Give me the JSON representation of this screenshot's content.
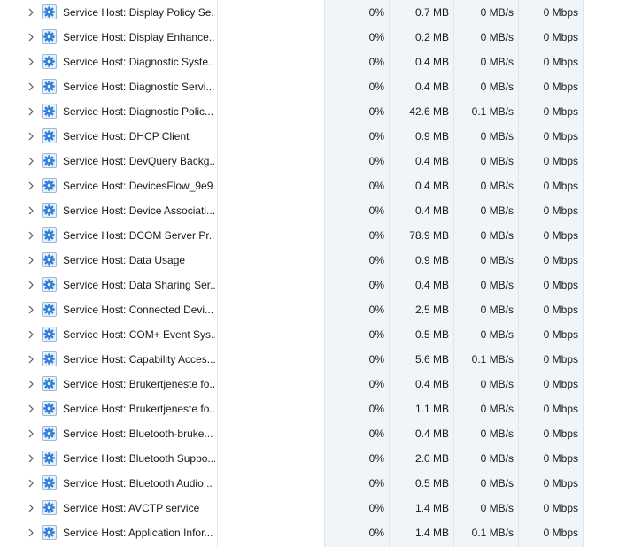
{
  "processes": [
    {
      "name": "Service Host: Display Policy Se...",
      "cpu": "0%",
      "memory": "0.7 MB",
      "disk": "0 MB/s",
      "network": "0 Mbps"
    },
    {
      "name": "Service Host: Display Enhance...",
      "cpu": "0%",
      "memory": "0.2 MB",
      "disk": "0 MB/s",
      "network": "0 Mbps"
    },
    {
      "name": "Service Host: Diagnostic Syste...",
      "cpu": "0%",
      "memory": "0.4 MB",
      "disk": "0 MB/s",
      "network": "0 Mbps"
    },
    {
      "name": "Service Host: Diagnostic Servi...",
      "cpu": "0%",
      "memory": "0.4 MB",
      "disk": "0 MB/s",
      "network": "0 Mbps"
    },
    {
      "name": "Service Host: Diagnostic Polic...",
      "cpu": "0%",
      "memory": "42.6 MB",
      "disk": "0.1 MB/s",
      "network": "0 Mbps"
    },
    {
      "name": "Service Host: DHCP Client",
      "cpu": "0%",
      "memory": "0.9 MB",
      "disk": "0 MB/s",
      "network": "0 Mbps"
    },
    {
      "name": "Service Host: DevQuery Backg...",
      "cpu": "0%",
      "memory": "0.4 MB",
      "disk": "0 MB/s",
      "network": "0 Mbps"
    },
    {
      "name": "Service Host: DevicesFlow_9e9...",
      "cpu": "0%",
      "memory": "0.4 MB",
      "disk": "0 MB/s",
      "network": "0 Mbps"
    },
    {
      "name": "Service Host: Device Associati...",
      "cpu": "0%",
      "memory": "0.4 MB",
      "disk": "0 MB/s",
      "network": "0 Mbps"
    },
    {
      "name": "Service Host: DCOM Server Pr...",
      "cpu": "0%",
      "memory": "78.9 MB",
      "disk": "0 MB/s",
      "network": "0 Mbps"
    },
    {
      "name": "Service Host: Data Usage",
      "cpu": "0%",
      "memory": "0.9 MB",
      "disk": "0 MB/s",
      "network": "0 Mbps"
    },
    {
      "name": "Service Host: Data Sharing Ser...",
      "cpu": "0%",
      "memory": "0.4 MB",
      "disk": "0 MB/s",
      "network": "0 Mbps"
    },
    {
      "name": "Service Host: Connected Devi...",
      "cpu": "0%",
      "memory": "2.5 MB",
      "disk": "0 MB/s",
      "network": "0 Mbps"
    },
    {
      "name": "Service Host: COM+ Event Sys...",
      "cpu": "0%",
      "memory": "0.5 MB",
      "disk": "0 MB/s",
      "network": "0 Mbps"
    },
    {
      "name": "Service Host: Capability Acces...",
      "cpu": "0%",
      "memory": "5.6 MB",
      "disk": "0.1 MB/s",
      "network": "0 Mbps"
    },
    {
      "name": "Service Host: Brukertjeneste fo...",
      "cpu": "0%",
      "memory": "0.4 MB",
      "disk": "0 MB/s",
      "network": "0 Mbps"
    },
    {
      "name": "Service Host: Brukertjeneste fo...",
      "cpu": "0%",
      "memory": "1.1 MB",
      "disk": "0 MB/s",
      "network": "0 Mbps"
    },
    {
      "name": "Service Host: Bluetooth-bruke...",
      "cpu": "0%",
      "memory": "0.4 MB",
      "disk": "0 MB/s",
      "network": "0 Mbps"
    },
    {
      "name": "Service Host: Bluetooth Suppo...",
      "cpu": "0%",
      "memory": "2.0 MB",
      "disk": "0 MB/s",
      "network": "0 Mbps"
    },
    {
      "name": "Service Host: Bluetooth Audio...",
      "cpu": "0%",
      "memory": "0.5 MB",
      "disk": "0 MB/s",
      "network": "0 Mbps"
    },
    {
      "name": "Service Host: AVCTP service",
      "cpu": "0%",
      "memory": "1.4 MB",
      "disk": "0 MB/s",
      "network": "0 Mbps"
    },
    {
      "name": "Service Host: Application Infor...",
      "cpu": "0%",
      "memory": "1.4 MB",
      "disk": "0.1 MB/s",
      "network": "0 Mbps"
    }
  ],
  "icons": {
    "expand": "chevron-right-icon",
    "process": "gear-icon"
  },
  "colors": {
    "metric_column_background": "#f0f5f9",
    "icon_blue": "#2f7fd8"
  }
}
